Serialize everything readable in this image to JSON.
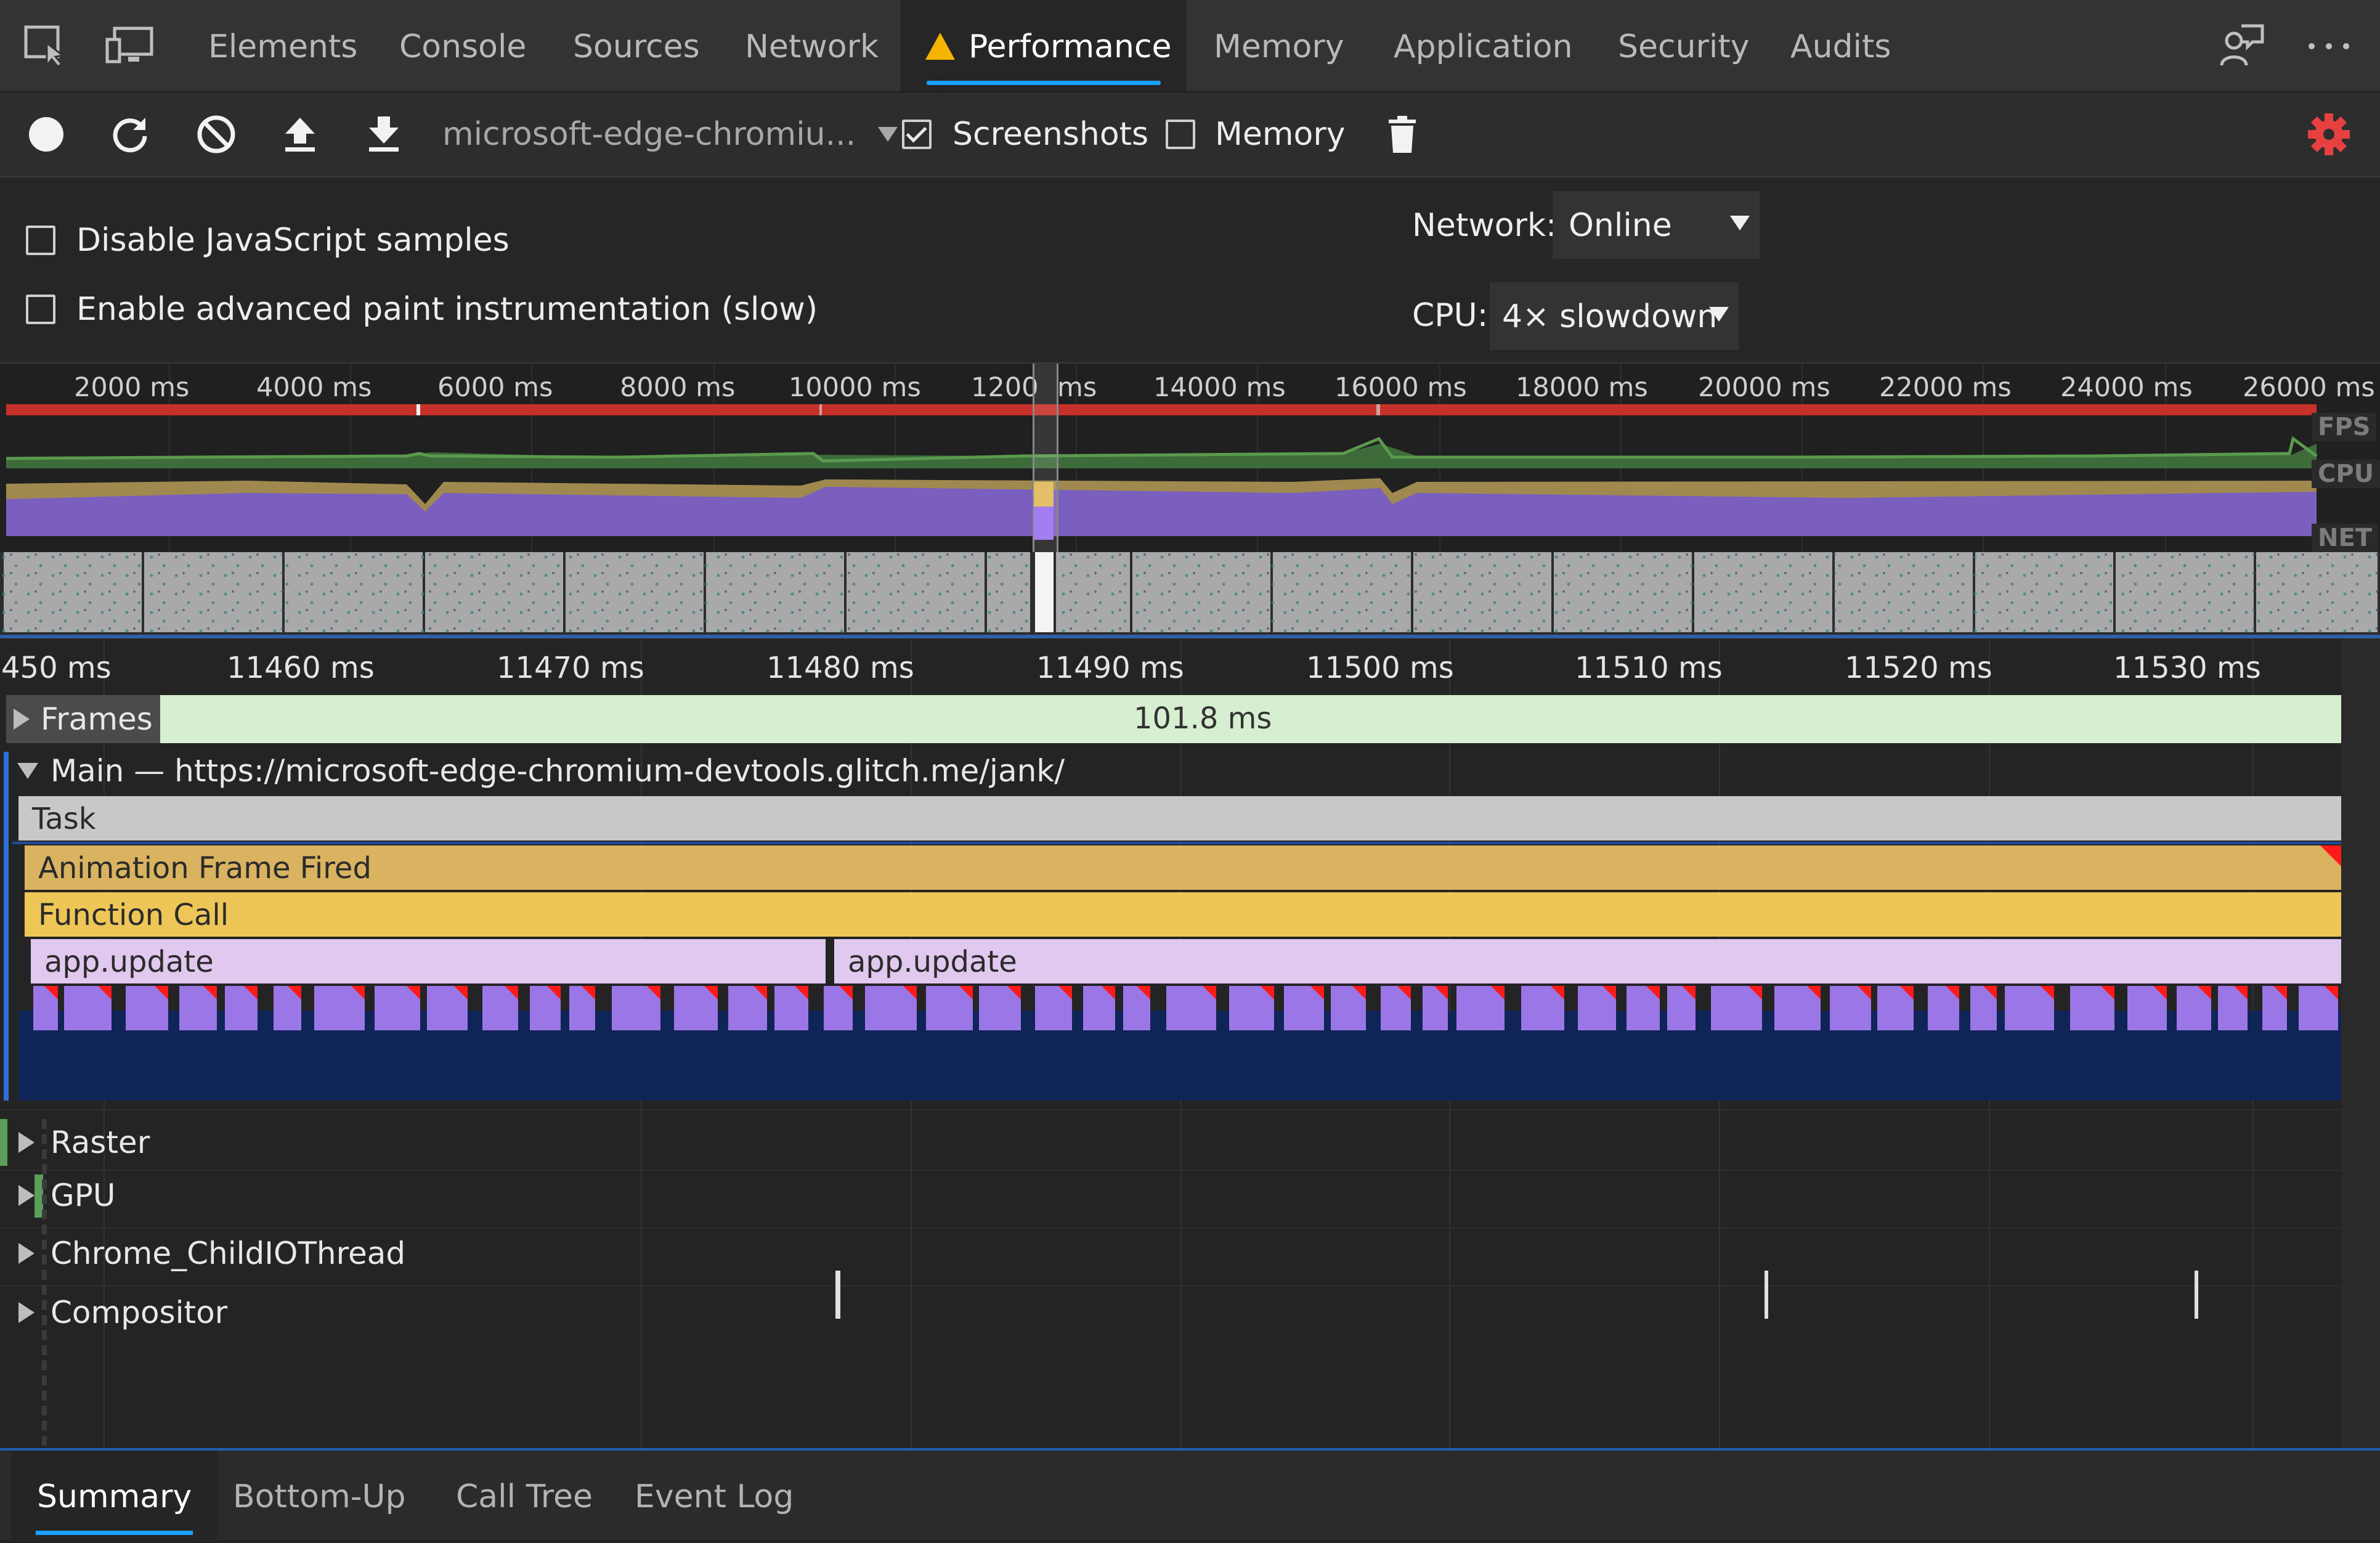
{
  "tabs": [
    {
      "label": "Elements",
      "active": false
    },
    {
      "label": "Console",
      "active": false
    },
    {
      "label": "Sources",
      "active": false
    },
    {
      "label": "Network",
      "active": false
    },
    {
      "label": "Performance",
      "active": true,
      "warning": true
    },
    {
      "label": "Memory",
      "active": false
    },
    {
      "label": "Application",
      "active": false
    },
    {
      "label": "Security",
      "active": false
    },
    {
      "label": "Audits",
      "active": false
    }
  ],
  "toolbar": {
    "profile_select": "microsoft-edge-chromiu...",
    "screenshots_label": "Screenshots",
    "screenshots_checked": true,
    "memory_label": "Memory",
    "memory_checked": false,
    "settings_color": "#e64040"
  },
  "settings": {
    "disable_js_label": "Disable JavaScript samples",
    "disable_js_checked": false,
    "paint_label": "Enable advanced paint instrumentation (slow)",
    "paint_checked": false,
    "network_label": "Network:",
    "network_value": "Online",
    "cpu_label": "CPU:",
    "cpu_value": "4× slowdown"
  },
  "overview": {
    "ticks": [
      "2000 ms",
      "4000 ms",
      "6000 ms",
      "8000 ms",
      "10000 ms",
      "1200",
      "ms",
      "14000 ms",
      "16000 ms",
      "18000 ms",
      "20000 ms",
      "22000 ms",
      "24000 ms",
      "26000 ms"
    ],
    "fps_label": "FPS",
    "cpu_label": "CPU",
    "net_label": "NET",
    "colors": {
      "fps_bar": "#c8302a",
      "fps_line": "#5a9a4e",
      "cpu_yellow": "#a0894f",
      "cpu_purple": "#7a5fbf"
    }
  },
  "flame": {
    "ticks": [
      "450 ms",
      "11460 ms",
      "11470 ms",
      "11480 ms",
      "11490 ms",
      "11500 ms",
      "11510 ms",
      "11520 ms",
      "11530 ms"
    ],
    "frames_label": "Frames",
    "frames_duration": "101.8 ms",
    "main_label": "Main — https://microsoft-edge-chromium-devtools.glitch.me/jank/",
    "task_label": "Task",
    "animation_label": "Animation Frame Fired",
    "function_label": "Function Call",
    "update_labels": [
      "app.update",
      "app.update"
    ],
    "tracks": [
      "Raster",
      "GPU",
      "Chrome_ChildIOThread",
      "Compositor"
    ],
    "colors": {
      "frames": "#d6efd0",
      "task": "#c8c8c8",
      "animation": "#d9b35f",
      "function": "#edc657",
      "update": "#e0c8ef",
      "layout": "#9b76e6",
      "forced": "#ff1a1a",
      "main_bg": "#0f2457"
    }
  },
  "bottom_tabs": [
    {
      "label": "Summary",
      "active": true
    },
    {
      "label": "Bottom-Up",
      "active": false
    },
    {
      "label": "Call Tree",
      "active": false
    },
    {
      "label": "Event Log",
      "active": false
    }
  ]
}
